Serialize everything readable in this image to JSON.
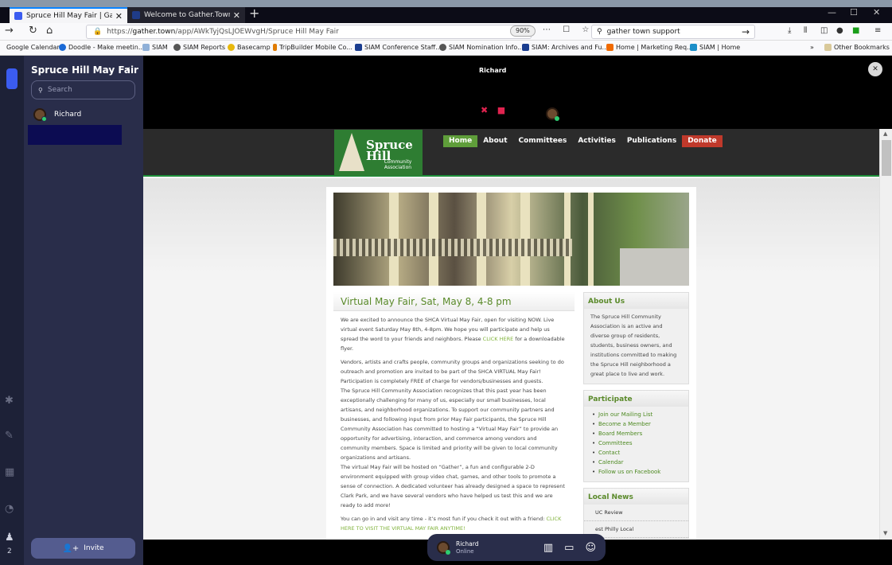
{
  "browser": {
    "tabs": [
      {
        "label": "Spruce Hill May Fair | Gather",
        "close": "✕"
      },
      {
        "label": "Welcome to Gather.Town's Hel",
        "close": "✕"
      }
    ],
    "new_tab": "+",
    "url_prefix": "https://",
    "url_host": "gather.town",
    "url_path": "/app/AWkTyjQsLJOEWvgH/Spruce Hill May Fair",
    "zoom": "90%",
    "search_value": "gather town support",
    "bookmarks": [
      "Google Calendar",
      "Doodle - Make meetin...",
      "SIAM",
      "SIAM Reports",
      "Basecamp",
      "TripBuilder Mobile Co...",
      "SIAM Conference Staff...",
      "SIAM Nomination Info...",
      "SIAM: Archives and Fu...",
      "Home | Marketing Req...",
      "SIAM | Home"
    ],
    "other_bookmarks": "Other Bookmarks"
  },
  "gather": {
    "space_title": "Spruce Hill May Fair",
    "search_placeholder": "Search",
    "members": [
      {
        "name": "Richard"
      }
    ],
    "invite_label": "Invite",
    "rail_count": "2",
    "video_name": "Richard",
    "dock": {
      "name": "Richard",
      "status": "Online"
    }
  },
  "site": {
    "logo_line1": "Spruce",
    "logo_line2": "Hill",
    "logo_sub1": "Community",
    "logo_sub2": "Association",
    "nav": [
      "Home",
      "About",
      "Committees",
      "Activities",
      "Publications",
      "Donate"
    ],
    "headline": "Virtual May Fair, Sat, May 8, 4-8 pm",
    "p1_a": "We are excited to announce the SHCA Virtual May Fair, open for visiting NOW. Live virtual event Saturday May 8th, 4-8pm. We hope you will participate and help us spread the word to your friends and neighbors. Please ",
    "p1_link": "CLICK HERE",
    "p1_b": " for a downloadable flyer.",
    "p2": "Vendors, artists and crafts people, community groups and organizations seeking to do outreach and promotion are invited to be part of the SHCA VIRTUAL May Fair! Participation is completely FREE of charge for vendors/businesses and guests.",
    "p3": "The Spruce Hill Community Association recognizes that this past year has been exceptionally challenging for many of us, especially our small businesses, local artisans, and neighborhood organizations. To support our community partners and businesses, and following input from prior May Fair participants, the Spruce Hill Community Association has committed to hosting a “Virtual May Fair” to provide an opportunity for advertising, interaction, and commerce among vendors and community members. Space is limited and priority will be given to local community organizations and artisans.",
    "p4": "The virtual May Fair will be hosted on “Gather”, a fun and configurable 2-D environment equipped with group video chat, games, and other tools to promote a sense of connection. A dedicated volunteer has already designed a space to represent Clark Park, and we have several vendors who have helped us test this and we are ready to add more!",
    "p5_a": "You can go in and visit any time - it’s most fun if you check it out with a friend: ",
    "p5_link": "CLICK HERE TO VISIT THE VIRTUAL MAY FAIR ANYTIME!",
    "about_title": "About Us",
    "about_text": "The Spruce Hill Community Association is an active and diverse group of residents, students, business owners, and institutions committed to making the Spruce Hill neighborhood a great place to live and work.",
    "participate_title": "Participate",
    "participate_items": [
      "Join our Mailing List",
      "Become a Member",
      "Board Members",
      "Committees",
      "Contact",
      "Calendar",
      "Follow us on Facebook"
    ],
    "news_title": "Local News",
    "news_items": [
      "UC Review",
      "est Philly Local"
    ]
  }
}
